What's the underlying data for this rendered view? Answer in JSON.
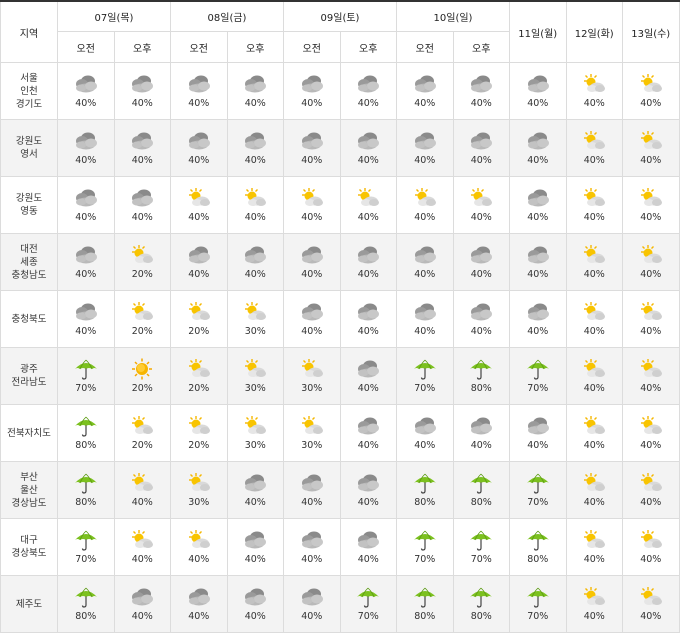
{
  "header": {
    "region_label": "지역",
    "days": [
      {
        "label": "07일(목)",
        "split": true
      },
      {
        "label": "08일(금)",
        "split": true
      },
      {
        "label": "09일(토)",
        "split": true
      },
      {
        "label": "10일(일)",
        "split": true
      },
      {
        "label": "11일(월)",
        "split": false
      },
      {
        "label": "12일(화)",
        "split": false
      },
      {
        "label": "13일(수)",
        "split": false
      }
    ],
    "am": "오전",
    "pm": "오후"
  },
  "legend_icons": {
    "cloudy": "cloud-icon",
    "partly": "sun-cloud-icon",
    "sunny": "sun-icon",
    "rain": "umbrella-icon"
  },
  "rows": [
    {
      "region": [
        "서울",
        "인천",
        "경기도"
      ],
      "cells": [
        [
          "cloudy",
          "40%"
        ],
        [
          "cloudy",
          "40%"
        ],
        [
          "cloudy",
          "40%"
        ],
        [
          "cloudy",
          "40%"
        ],
        [
          "cloudy",
          "40%"
        ],
        [
          "cloudy",
          "40%"
        ],
        [
          "cloudy",
          "40%"
        ],
        [
          "cloudy",
          "40%"
        ],
        [
          "cloudy",
          "40%"
        ],
        [
          "partly",
          "40%"
        ],
        [
          "partly",
          "40%"
        ]
      ]
    },
    {
      "region": [
        "강원도",
        "영서"
      ],
      "cells": [
        [
          "cloudy",
          "40%"
        ],
        [
          "cloudy",
          "40%"
        ],
        [
          "cloudy",
          "40%"
        ],
        [
          "cloudy",
          "40%"
        ],
        [
          "cloudy",
          "40%"
        ],
        [
          "cloudy",
          "40%"
        ],
        [
          "cloudy",
          "40%"
        ],
        [
          "cloudy",
          "40%"
        ],
        [
          "cloudy",
          "40%"
        ],
        [
          "partly",
          "40%"
        ],
        [
          "partly",
          "40%"
        ]
      ]
    },
    {
      "region": [
        "강원도",
        "영동"
      ],
      "cells": [
        [
          "cloudy",
          "40%"
        ],
        [
          "cloudy",
          "40%"
        ],
        [
          "partly",
          "40%"
        ],
        [
          "partly",
          "40%"
        ],
        [
          "partly",
          "40%"
        ],
        [
          "partly",
          "40%"
        ],
        [
          "partly",
          "40%"
        ],
        [
          "partly",
          "40%"
        ],
        [
          "cloudy",
          "40%"
        ],
        [
          "partly",
          "40%"
        ],
        [
          "partly",
          "40%"
        ]
      ]
    },
    {
      "region": [
        "대전",
        "세종",
        "충청남도"
      ],
      "cells": [
        [
          "cloudy",
          "40%"
        ],
        [
          "partly",
          "20%"
        ],
        [
          "cloudy",
          "40%"
        ],
        [
          "cloudy",
          "40%"
        ],
        [
          "cloudy",
          "40%"
        ],
        [
          "cloudy",
          "40%"
        ],
        [
          "cloudy",
          "40%"
        ],
        [
          "cloudy",
          "40%"
        ],
        [
          "cloudy",
          "40%"
        ],
        [
          "partly",
          "40%"
        ],
        [
          "partly",
          "40%"
        ]
      ]
    },
    {
      "region": [
        "충청북도"
      ],
      "cells": [
        [
          "cloudy",
          "40%"
        ],
        [
          "partly",
          "20%"
        ],
        [
          "partly",
          "20%"
        ],
        [
          "partly",
          "30%"
        ],
        [
          "cloudy",
          "40%"
        ],
        [
          "cloudy",
          "40%"
        ],
        [
          "cloudy",
          "40%"
        ],
        [
          "cloudy",
          "40%"
        ],
        [
          "cloudy",
          "40%"
        ],
        [
          "partly",
          "40%"
        ],
        [
          "partly",
          "40%"
        ]
      ]
    },
    {
      "region": [
        "광주",
        "전라남도"
      ],
      "cells": [
        [
          "rain",
          "70%"
        ],
        [
          "sunny",
          "20%"
        ],
        [
          "partly",
          "20%"
        ],
        [
          "partly",
          "30%"
        ],
        [
          "partly",
          "30%"
        ],
        [
          "cloudy",
          "40%"
        ],
        [
          "rain",
          "70%"
        ],
        [
          "rain",
          "80%"
        ],
        [
          "rain",
          "70%"
        ],
        [
          "partly",
          "40%"
        ],
        [
          "partly",
          "40%"
        ]
      ]
    },
    {
      "region": [
        "전북자치도"
      ],
      "cells": [
        [
          "rain",
          "80%"
        ],
        [
          "partly",
          "20%"
        ],
        [
          "partly",
          "20%"
        ],
        [
          "partly",
          "30%"
        ],
        [
          "partly",
          "30%"
        ],
        [
          "cloudy",
          "40%"
        ],
        [
          "cloudy",
          "40%"
        ],
        [
          "cloudy",
          "40%"
        ],
        [
          "cloudy",
          "40%"
        ],
        [
          "partly",
          "40%"
        ],
        [
          "partly",
          "40%"
        ]
      ]
    },
    {
      "region": [
        "부산",
        "울산",
        "경상남도"
      ],
      "cells": [
        [
          "rain",
          "80%"
        ],
        [
          "partly",
          "40%"
        ],
        [
          "partly",
          "30%"
        ],
        [
          "cloudy",
          "40%"
        ],
        [
          "cloudy",
          "40%"
        ],
        [
          "cloudy",
          "40%"
        ],
        [
          "rain",
          "80%"
        ],
        [
          "rain",
          "80%"
        ],
        [
          "rain",
          "70%"
        ],
        [
          "partly",
          "40%"
        ],
        [
          "partly",
          "40%"
        ]
      ]
    },
    {
      "region": [
        "대구",
        "경상북도"
      ],
      "cells": [
        [
          "rain",
          "70%"
        ],
        [
          "partly",
          "40%"
        ],
        [
          "partly",
          "40%"
        ],
        [
          "cloudy",
          "40%"
        ],
        [
          "cloudy",
          "40%"
        ],
        [
          "cloudy",
          "40%"
        ],
        [
          "rain",
          "70%"
        ],
        [
          "rain",
          "70%"
        ],
        [
          "rain",
          "80%"
        ],
        [
          "partly",
          "40%"
        ],
        [
          "partly",
          "40%"
        ]
      ]
    },
    {
      "region": [
        "제주도"
      ],
      "cells": [
        [
          "rain",
          "80%"
        ],
        [
          "cloudy",
          "40%"
        ],
        [
          "cloudy",
          "40%"
        ],
        [
          "cloudy",
          "40%"
        ],
        [
          "cloudy",
          "40%"
        ],
        [
          "rain",
          "70%"
        ],
        [
          "rain",
          "80%"
        ],
        [
          "rain",
          "80%"
        ],
        [
          "rain",
          "70%"
        ],
        [
          "partly",
          "40%"
        ],
        [
          "partly",
          "40%"
        ]
      ]
    }
  ]
}
